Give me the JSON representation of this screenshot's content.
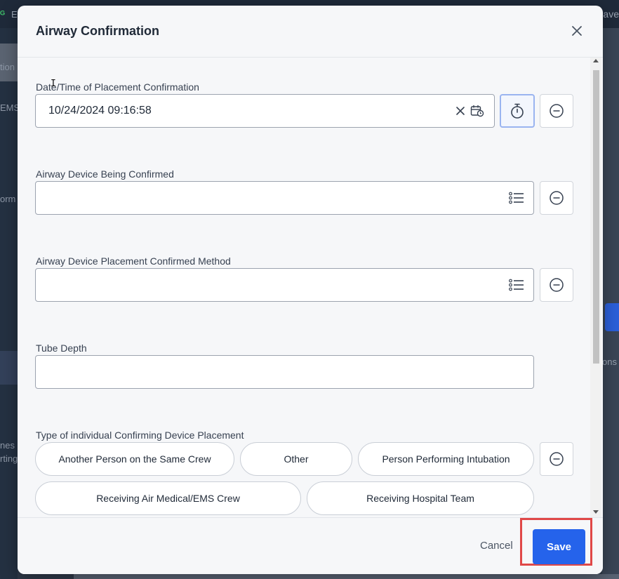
{
  "background": {
    "app_name_fragment": "E",
    "top_save_fragment": "Save",
    "sidebar_fragments": [
      "tion",
      "EMS",
      "orm",
      "nes a",
      "rting"
    ],
    "right_fragment": "ons"
  },
  "modal": {
    "title": "Airway Confirmation",
    "close_icon": "close-icon"
  },
  "fields": {
    "datetime": {
      "label": "Date/Time of Placement Confirmation",
      "value": "10/24/2024 09:16:58",
      "icons": [
        "clear-icon",
        "calendar-clock-icon",
        "stopwatch-icon",
        "minus-circle-icon"
      ]
    },
    "device": {
      "label": "Airway Device Being Confirmed",
      "value": "",
      "icons": [
        "list-icon",
        "minus-circle-icon"
      ]
    },
    "method": {
      "label": "Airway Device Placement Confirmed Method",
      "value": "",
      "icons": [
        "list-icon",
        "minus-circle-icon"
      ]
    },
    "tube_depth": {
      "label": "Tube Depth",
      "value": ""
    },
    "confirming_individual": {
      "label": "Type of individual Confirming Device Placement",
      "options": [
        "Another Person on the Same Crew",
        "Other",
        "Person Performing Intubation",
        "Receiving Air Medical/EMS Crew",
        "Receiving Hospital Team"
      ]
    }
  },
  "footer": {
    "cancel_label": "Cancel",
    "save_label": "Save",
    "highlight_color": "#e04848",
    "primary_color": "#2563eb"
  }
}
